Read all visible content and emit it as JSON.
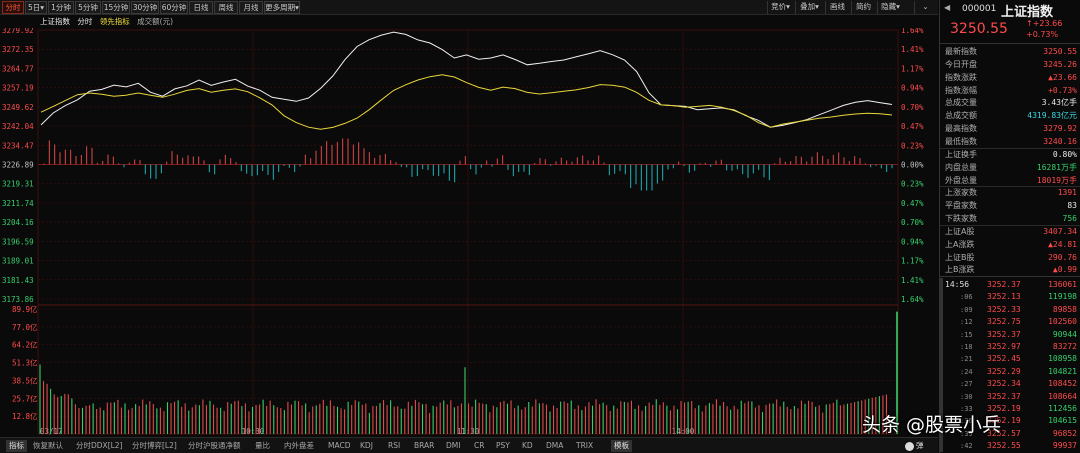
{
  "period_tabs": [
    "分时",
    "5日",
    "1分钟",
    "5分钟",
    "15分钟",
    "30分钟",
    "60分钟",
    "日线",
    "周线",
    "月线",
    "更多周期"
  ],
  "right_tools": [
    "竞价",
    "叠加",
    "画线",
    "简约",
    "隐藏"
  ],
  "legend": {
    "index": "上证指数",
    "time": "分时",
    "lead": "领先指标",
    "amount": "成交额(元)"
  },
  "chart_data": {
    "type": "line",
    "title": "",
    "x_labels": [
      "03/17",
      "10:30",
      "11:30",
      "14:00"
    ],
    "price_axis": [
      "3279.92",
      "3272.35",
      "3264.77",
      "3257.19",
      "3249.62",
      "3242.04",
      "3234.47",
      "3226.89",
      "3219.31",
      "3211.74",
      "3204.16",
      "3196.59",
      "3189.01",
      "3181.43",
      "3173.86"
    ],
    "pct_axis": [
      "1.64%",
      "1.41%",
      "1.17%",
      "0.94%",
      "0.70%",
      "0.47%",
      "0.23%",
      "0.00%",
      "0.23%",
      "0.47%",
      "0.70%",
      "0.94%",
      "1.17%",
      "1.41%",
      "1.64%"
    ],
    "vol_axis": [
      "89.9亿",
      "77.0亿",
      "64.2亿",
      "51.3亿",
      "38.5亿",
      "25.7亿",
      "12.8亿"
    ],
    "prev_close": 3226.89,
    "ylim": [
      3173.86,
      3279.92
    ],
    "series": [
      {
        "name": "上证指数",
        "color": "#f0f0f0",
        "values": [
          3242.5,
          3247.2,
          3250.1,
          3252.4,
          3255.8,
          3256.5,
          3258.2,
          3257.5,
          3258.9,
          3255.4,
          3253.8,
          3256.7,
          3257.9,
          3260.2,
          3258.1,
          3259.4,
          3260.5,
          3257.8,
          3256.2,
          3253.4,
          3252.6,
          3251.8,
          3253.1,
          3256.9,
          3261.8,
          3268.2,
          3273.4,
          3276.1,
          3277.9,
          3279.1,
          3278.2,
          3276.0,
          3274.8,
          3272.2,
          3268.9,
          3270.1,
          3268.4,
          3268.9,
          3270.1,
          3268.3,
          3266.2,
          3266.8,
          3267.5,
          3268.1,
          3269.3,
          3270.5,
          3271.8,
          3270.2,
          3268.1,
          3263.5,
          3255.2,
          3250.4,
          3250.1,
          3249.8,
          3248.5,
          3248.9,
          3249.2,
          3248.4,
          3246.1,
          3244.3,
          3241.6,
          3242.3,
          3243.4,
          3244.6,
          3246.5,
          3248.3,
          3250.2,
          3251.4,
          3252.1,
          3251.3,
          3250.55
        ]
      },
      {
        "name": "领先指标",
        "color": "#e8d83a",
        "values": [
          3247.5,
          3249.8,
          3252.1,
          3254.4,
          3255.1,
          3254.6,
          3253.8,
          3254.2,
          3255.1,
          3254.2,
          3253.4,
          3254.6,
          3256.1,
          3256.8,
          3255.4,
          3256.2,
          3256.7,
          3255.6,
          3253.2,
          3250.4,
          3246.1,
          3243.4,
          3241.6,
          3240.8,
          3241.5,
          3243.1,
          3245.2,
          3248.5,
          3252.4,
          3256.1,
          3258.3,
          3260.2,
          3261.5,
          3262.3,
          3261.4,
          3259.2,
          3257.3,
          3256.2,
          3257.4,
          3256.8,
          3255.3,
          3254.7,
          3255.2,
          3255.8,
          3256.3,
          3257.2,
          3258.4,
          3258.1,
          3257.4,
          3255.3,
          3252.2,
          3250.4,
          3250.1,
          3249.5,
          3249.8,
          3250.2,
          3249.5,
          3248.2,
          3246.3,
          3243.4,
          3241.6,
          3242.8,
          3243.6,
          3244.3,
          3245.1,
          3245.6,
          3246.3,
          3246.8,
          3247.1,
          3246.9,
          3246.4
        ]
      }
    ],
    "volume_max": 89.9,
    "volume_last": 88.0
  },
  "bottom_tabs": [
    "指标",
    "恢复默认",
    "分时DDX[L2]",
    "分时博弈[L2]",
    "分时沪股通净额",
    "量比",
    "内外盘差",
    "MACD",
    "KDJ",
    "RSI",
    "BRAR",
    "DMI",
    "CR",
    "PSY",
    "KD",
    "DMA",
    "TRIX",
    "模板"
  ],
  "bottom_end": "弹",
  "quote": {
    "code": "000001",
    "name": "上证指数",
    "price": "3250.55",
    "change": "+23.66",
    "change_pct": "+0.73%",
    "rows": [
      {
        "label": "最新指数",
        "value": "3250.55",
        "color": "red"
      },
      {
        "label": "今日开盘",
        "value": "3245.26",
        "color": "red"
      },
      {
        "label": "指数涨跌",
        "value": "▲23.66",
        "color": "red"
      },
      {
        "label": "指数涨幅",
        "value": "+0.73%",
        "color": "red"
      },
      {
        "label": "总成交量",
        "value": "3.43亿手",
        "color": "white"
      },
      {
        "label": "总成交额",
        "value": "4319.83亿元",
        "color": "cyan"
      },
      {
        "label": "最高指数",
        "value": "3279.92",
        "color": "red"
      },
      {
        "label": "最低指数",
        "value": "3240.16",
        "color": "red"
      },
      {
        "label": "上证换手",
        "value": "0.80%",
        "color": "white"
      },
      {
        "label": "内盘总量",
        "value": "16281万手",
        "color": "green"
      },
      {
        "label": "外盘总量",
        "value": "18019万手",
        "color": "red"
      },
      {
        "label": "上涨家数",
        "value": "1391",
        "color": "red"
      },
      {
        "label": "平盘家数",
        "value": "83",
        "color": "white"
      },
      {
        "label": "下跌家数",
        "value": "756",
        "color": "green"
      },
      {
        "label": "上证A股",
        "value": "3407.34",
        "color": "red"
      },
      {
        "label": "上A涨跌",
        "value": "▲24.81",
        "color": "red"
      },
      {
        "label": "上证B股",
        "value": "290.76",
        "color": "red"
      },
      {
        "label": "上B涨跌",
        "value": "▲0.99",
        "color": "red"
      }
    ]
  },
  "trades": [
    {
      "time": "14:56",
      "price": "3252.37",
      "vol": "136061",
      "vcolor": "red"
    },
    {
      "time": ":06",
      "price": "3252.13",
      "vol": "119198",
      "vcolor": "green"
    },
    {
      "time": ":09",
      "price": "3252.33",
      "vol": "89858",
      "vcolor": "red"
    },
    {
      "time": ":12",
      "price": "3252.75",
      "vol": "102560",
      "vcolor": "red"
    },
    {
      "time": ":15",
      "price": "3252.37",
      "vol": "90944",
      "vcolor": "green"
    },
    {
      "time": ":18",
      "price": "3252.97",
      "vol": "83272",
      "vcolor": "red"
    },
    {
      "time": ":21",
      "price": "3252.45",
      "vol": "108958",
      "vcolor": "green"
    },
    {
      "time": ":24",
      "price": "3252.29",
      "vol": "104821",
      "vcolor": "green"
    },
    {
      "time": ":27",
      "price": "3252.34",
      "vol": "108452",
      "vcolor": "red"
    },
    {
      "time": ":30",
      "price": "3252.37",
      "vol": "108664",
      "vcolor": "red"
    },
    {
      "time": ":33",
      "price": "3252.19",
      "vol": "112456",
      "vcolor": "green"
    },
    {
      "time": ":36",
      "price": "3252.19",
      "vol": "104615",
      "vcolor": "green"
    },
    {
      "time": ":39",
      "price": "3252.57",
      "vol": "96852",
      "vcolor": "red"
    },
    {
      "time": ":42",
      "price": "3252.55",
      "vol": "99937",
      "vcolor": "red"
    }
  ],
  "watermark": "头条 @股票小兵",
  "colors": {
    "up": "#ff4b4b",
    "down": "#37d06b",
    "grid": "#5a1414",
    "bar_down": "#1fb3b8"
  }
}
